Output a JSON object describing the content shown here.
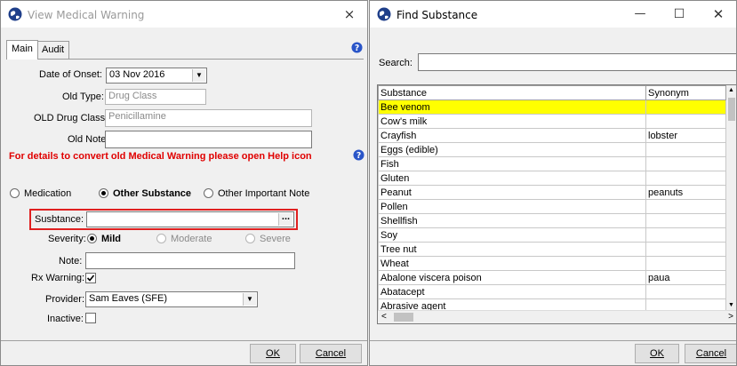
{
  "left": {
    "title": "View Medical Warning",
    "close_glyph": "×",
    "tabs": [
      {
        "label": "Main"
      },
      {
        "label": "Audit"
      }
    ],
    "form": {
      "date_of_onset_label": "Date of Onset:",
      "date_of_onset_value": "03 Nov 2016",
      "old_type_label": "Old Type:",
      "old_type_value": "Drug Class",
      "old_drug_class_label": "OLD Drug Class",
      "old_drug_class_value": "Penicillamine",
      "old_note_label": "Old Note:",
      "old_note_value": "",
      "warning_text": "For details to convert old Medical Warning please open Help icon",
      "radio_medication": "Medication",
      "radio_other_substance": "Other Substance",
      "radio_other_important_note": "Other Important Note",
      "substance_label": "Susbtance:",
      "substance_value": "",
      "ellipsis": "...",
      "severity_label": "Severity:",
      "severity_mild": "Mild",
      "severity_moderate": "Moderate",
      "severity_severe": "Severe",
      "note_label": "Note:",
      "note_value": "",
      "rx_warning_label": "Rx Warning:",
      "provider_label": "Provider:",
      "provider_value": "Sam Eaves (SFE)",
      "inactive_label": "Inactive:"
    },
    "ok_label": "OK",
    "cancel_label": "Cancel"
  },
  "right": {
    "title": "Find Substance",
    "min_glyph": "—",
    "max_glyph": "☐",
    "close_glyph": "✕",
    "search_label": "Search:",
    "search_value": "",
    "columns": [
      "Substance",
      "Synonym"
    ],
    "rows": [
      {
        "substance": "Bee venom",
        "synonym": ""
      },
      {
        "substance": "Cow's milk",
        "synonym": ""
      },
      {
        "substance": "Crayfish",
        "synonym": "lobster"
      },
      {
        "substance": "Eggs (edible)",
        "synonym": ""
      },
      {
        "substance": "Fish",
        "synonym": ""
      },
      {
        "substance": "Gluten",
        "synonym": ""
      },
      {
        "substance": "Peanut",
        "synonym": "peanuts"
      },
      {
        "substance": "Pollen",
        "synonym": ""
      },
      {
        "substance": "Shellfish",
        "synonym": ""
      },
      {
        "substance": "Soy",
        "synonym": ""
      },
      {
        "substance": "Tree nut",
        "synonym": ""
      },
      {
        "substance": "Wheat",
        "synonym": ""
      },
      {
        "substance": "Abalone viscera poison",
        "synonym": "paua"
      },
      {
        "substance": "Abatacept",
        "synonym": ""
      },
      {
        "substance": "Abrasive agent",
        "synonym": ""
      }
    ],
    "ok_label": "OK",
    "cancel_label": "Cancel"
  },
  "colors": {
    "highlight": "#ffff00",
    "warning_red": "#e00000",
    "focus_red": "#e02020",
    "help_blue": "#2a55c8"
  },
  "icons": [
    "app-globe-icon",
    "help-icon",
    "checkmark-icon",
    "chevron-down-icon",
    "scroll-left-icon",
    "scroll-right-icon",
    "scroll-up-icon",
    "scroll-down-icon"
  ]
}
